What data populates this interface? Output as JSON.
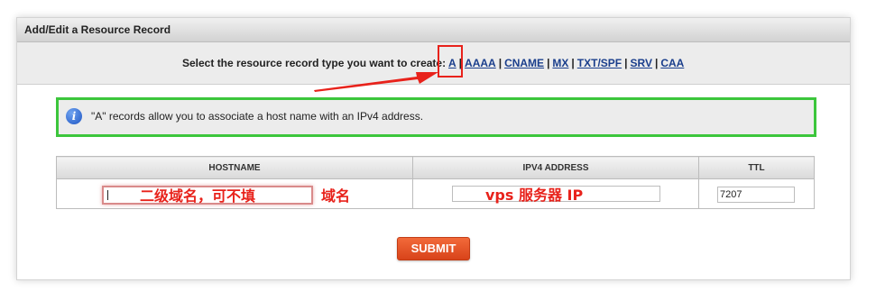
{
  "window": {
    "title": "Add/Edit a Resource Record"
  },
  "type_select": {
    "prompt": "Select the resource record type you want to create:",
    "types": [
      "A",
      "AAAA",
      "CNAME",
      "MX",
      "TXT/SPF",
      "SRV",
      "CAA"
    ],
    "selected": "A"
  },
  "info": {
    "text": "\"A\" records allow you to associate a host name with an IPv4 address."
  },
  "table": {
    "headers": {
      "hostname": "HOSTNAME",
      "ipv4": "IPV4 ADDRESS",
      "ttl": "TTL"
    },
    "hostname_value": "",
    "ipv4_value": "",
    "ttl_value": "7207"
  },
  "annotations": {
    "hostname_hint": "二级域名，可不填",
    "domain_hint": "域名",
    "ip_hint": "vps 服务器 IP"
  },
  "actions": {
    "submit_label": "SUBMIT"
  },
  "colors": {
    "annotation_red": "#e8221b",
    "info_border": "#3cc63c",
    "submit": "#e0521f",
    "link": "#1a3e8c"
  }
}
